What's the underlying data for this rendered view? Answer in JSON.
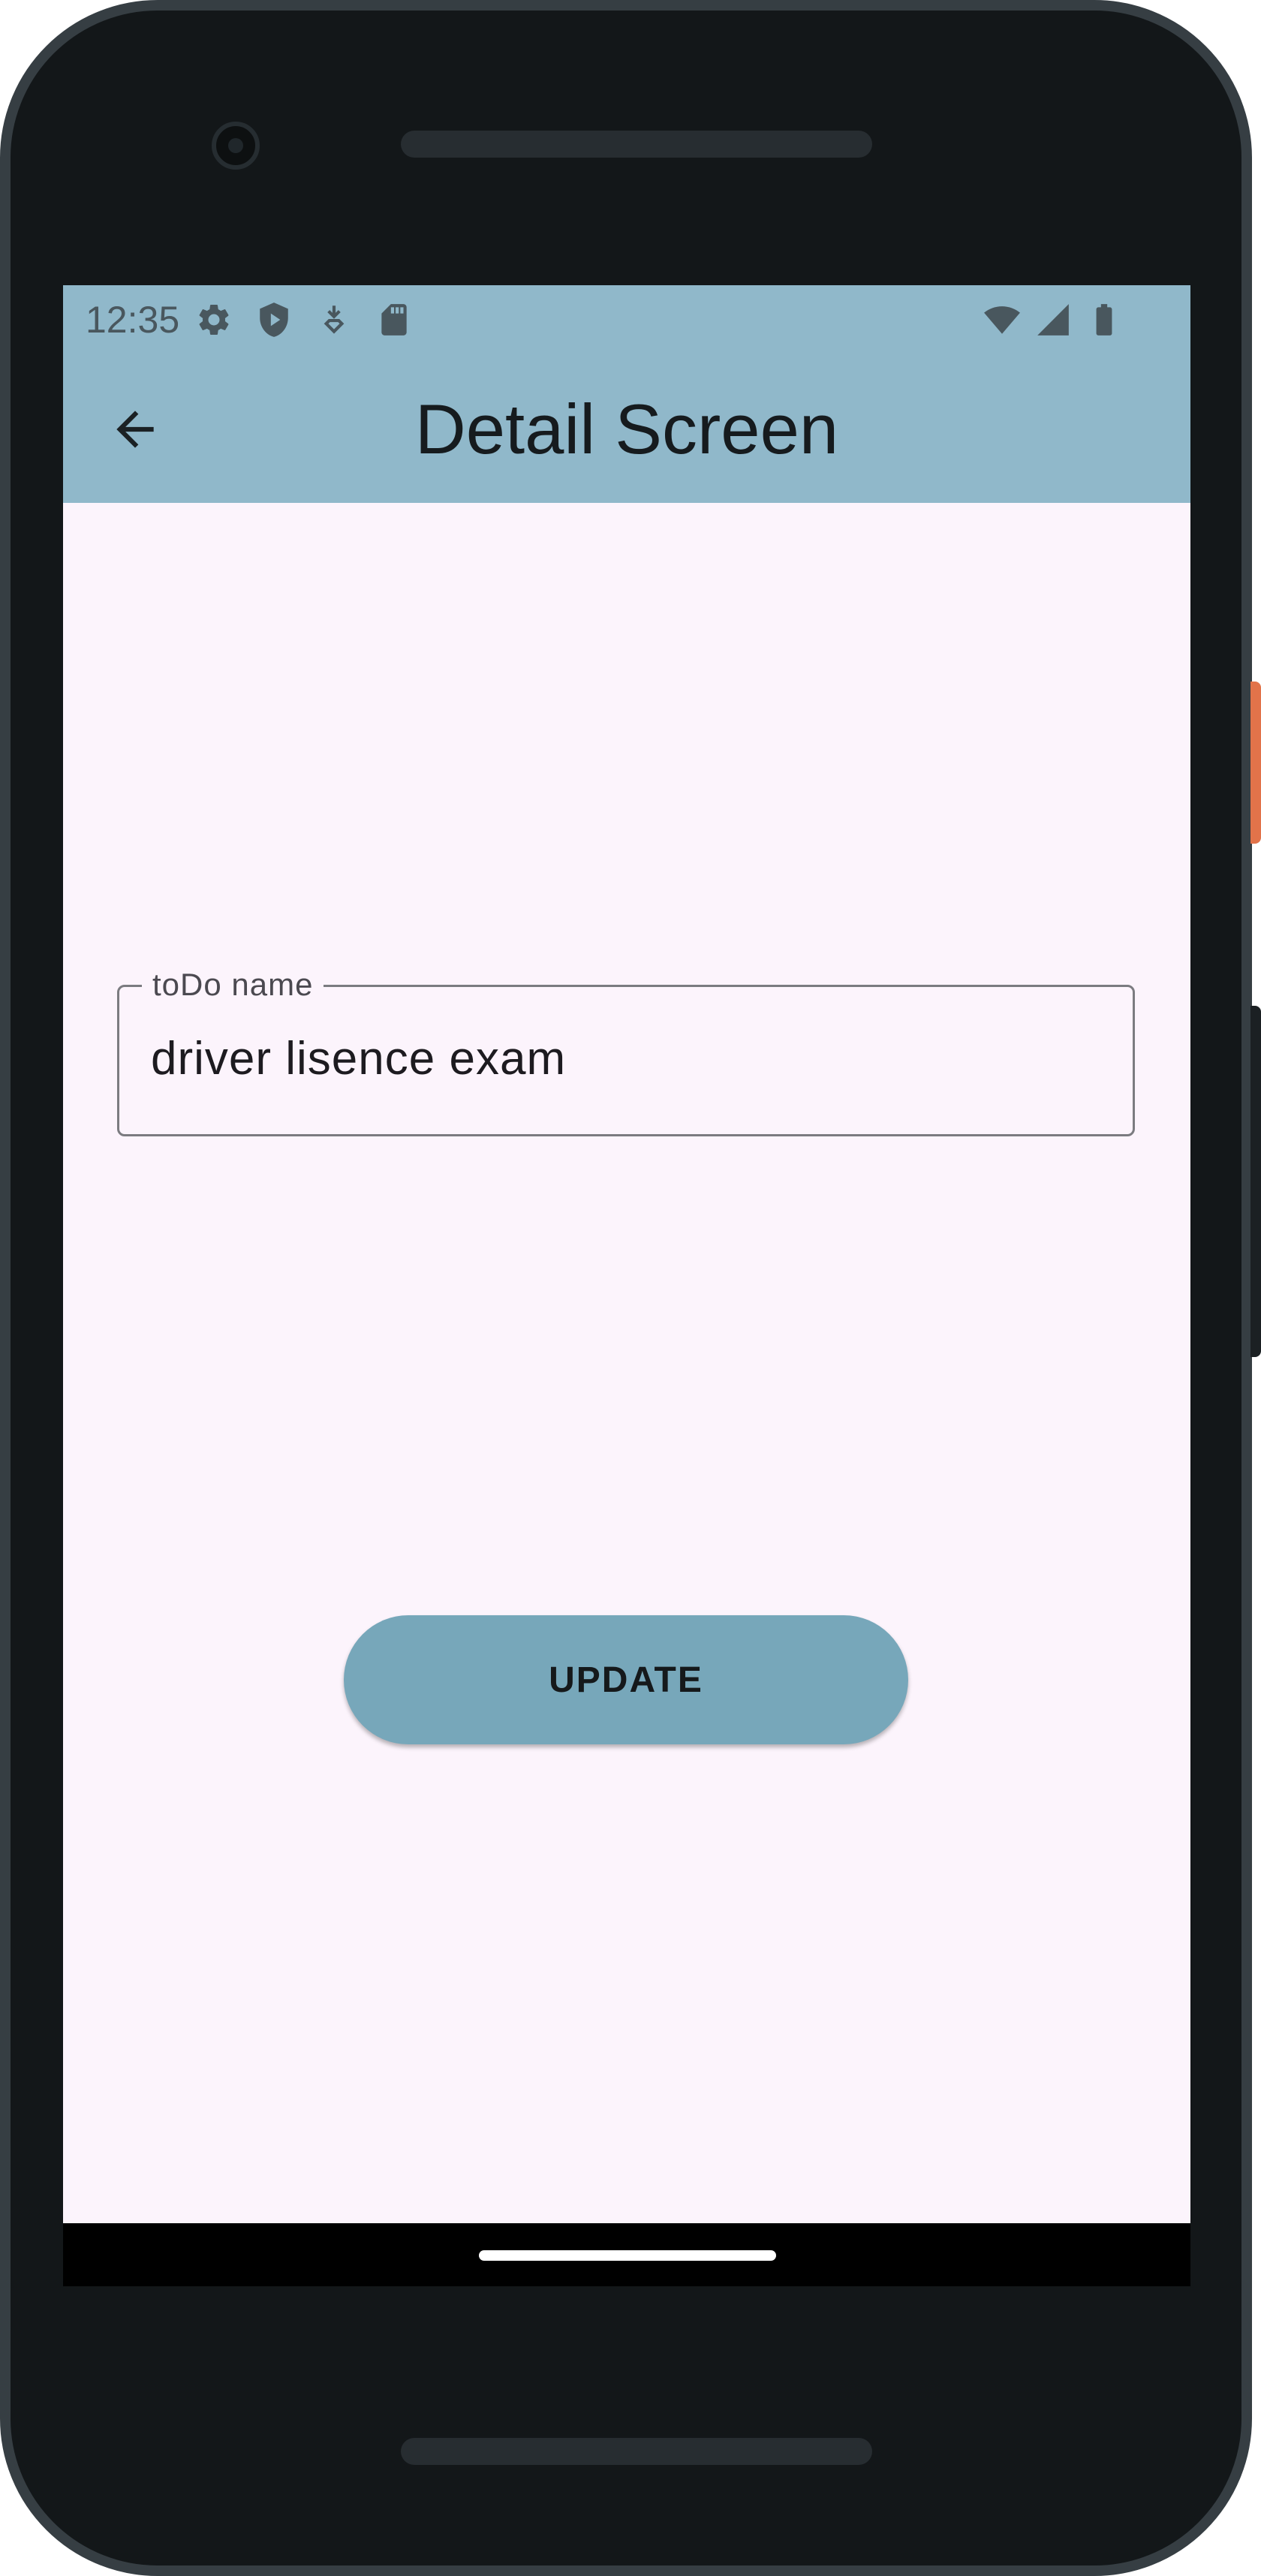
{
  "status_bar": {
    "time": "12:35",
    "left_icons": [
      "settings-icon",
      "shield-play-icon",
      "download-icon",
      "sd-card-icon"
    ],
    "right_icons": [
      "wifi-icon",
      "cell-signal-icon",
      "battery-icon"
    ],
    "icon_color": "#49575e"
  },
  "app_bar": {
    "title": "Detail Screen",
    "back_icon": "arrow-back-icon",
    "background": "#90b8ca"
  },
  "form": {
    "todo_field": {
      "label": "toDo name",
      "value": "driver lisence exam"
    }
  },
  "actions": {
    "update_label": "UPDATE",
    "update_color": "#77a7ba"
  },
  "theme": {
    "screen_background": "#fcf4fc",
    "device_frame": "#131719",
    "power_button": "#e2734a"
  }
}
